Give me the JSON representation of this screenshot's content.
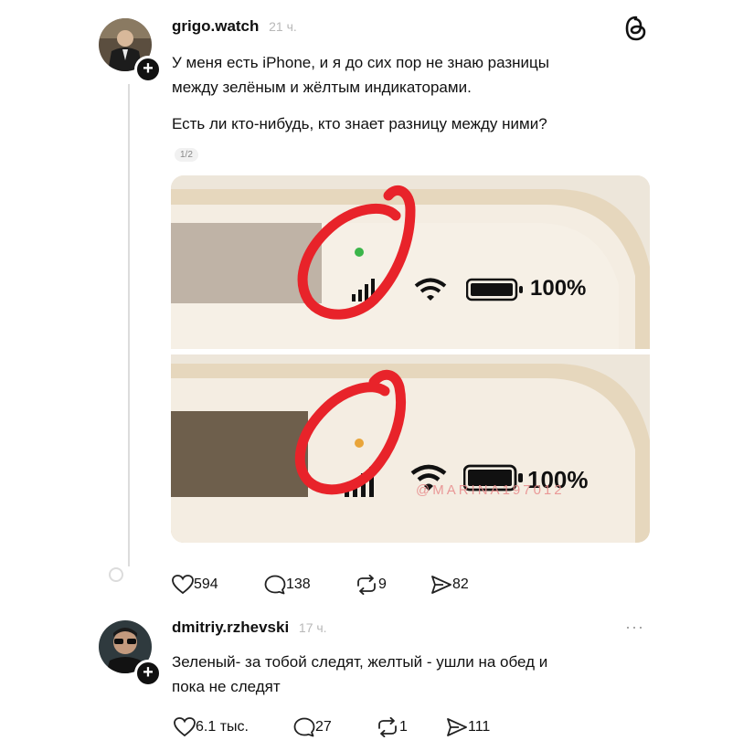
{
  "post": {
    "username": "grigo.watch",
    "time": "21 ч.",
    "text_line1": "У меня есть iPhone, и я до сих пор не знаю разницы",
    "text_line2": "между зелёным и жёлтым индикаторами.",
    "text_line3": "Есть ли кто-нибудь, кто знает разницу между ними?",
    "pager": "1/2",
    "image": {
      "top_battery": "100%",
      "bottom_battery": "100%",
      "watermark": "@MARINA197012",
      "indicator_top_color": "#3bb54a",
      "indicator_bottom_color": "#e9a53a"
    },
    "actions": {
      "likes": "594",
      "comments": "138",
      "reposts": "9",
      "shares": "82"
    }
  },
  "reply": {
    "username": "dmitriy.rzhevski",
    "time": "17 ч.",
    "text_line1": "Зеленый- за тобой следят, желтый - ушли на обед и",
    "text_line2": "пока не следят",
    "more": "···",
    "actions": {
      "likes": "6.1 тыс.",
      "comments": "27",
      "reposts": "1",
      "shares": "111"
    }
  },
  "icons": {
    "brand": "threads-icon",
    "like": "heart-icon",
    "comment": "comment-icon",
    "repost": "repost-icon",
    "share": "share-icon",
    "add": "plus-icon"
  },
  "colors": {
    "annotation": "#e8232a",
    "text": "#111111",
    "muted": "#b8b8b8"
  }
}
